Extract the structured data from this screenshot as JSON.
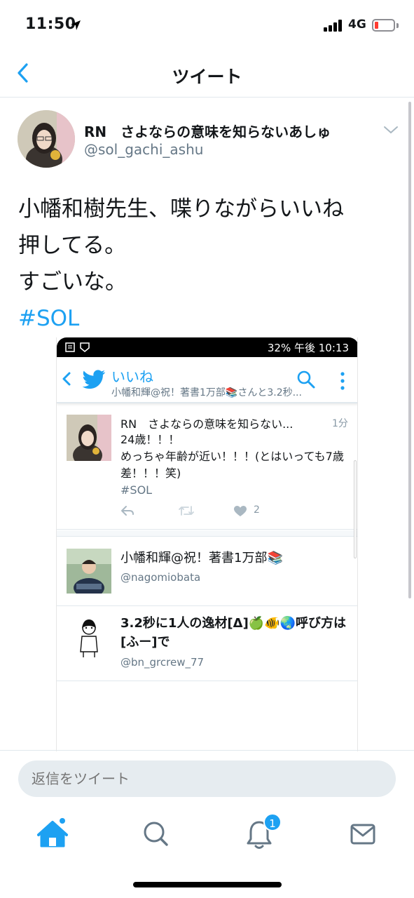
{
  "status_bar": {
    "time": "11:50",
    "network": "4G"
  },
  "nav": {
    "title": "ツイート"
  },
  "tweet": {
    "author_name": "RN　さよならの意味を知らないあしゅ",
    "author_handle": "@sol_gachi_ashu",
    "lines": [
      "小幡和樹先生、喋りながらいいね",
      "押してる。",
      "すごいな。"
    ],
    "hashtag": "#SOL"
  },
  "embedded": {
    "status_right": "32% 午後 10:13",
    "title": "いいね",
    "subtitle": "小幡和輝@祝！著書1万部📚さんと3.2秒...",
    "tweet": {
      "name": "RN　さよならの意味を知らない...",
      "time": "1分",
      "text_line1": "24歳！！！",
      "text_line2": "めっちゃ年齢が近い！！！(とはいっても7歳差！！！笑)",
      "hashtag": "#SOL",
      "like_count": "2"
    },
    "users": [
      {
        "name": "小幡和輝@祝！著書1万部📚",
        "handle": "@nagomiobata"
      },
      {
        "name": "3.2秒に1人の逸材[Δ]🍏🐠🌏呼び方は[ふー]で",
        "handle": "@bn_grcrew_77"
      }
    ]
  },
  "reply": {
    "placeholder": "返信をツイート"
  },
  "tabs": {
    "notification_badge": "1"
  },
  "colors": {
    "accent": "#1da1f2",
    "secondary_text": "#657786",
    "divider": "#e1e8ed"
  }
}
